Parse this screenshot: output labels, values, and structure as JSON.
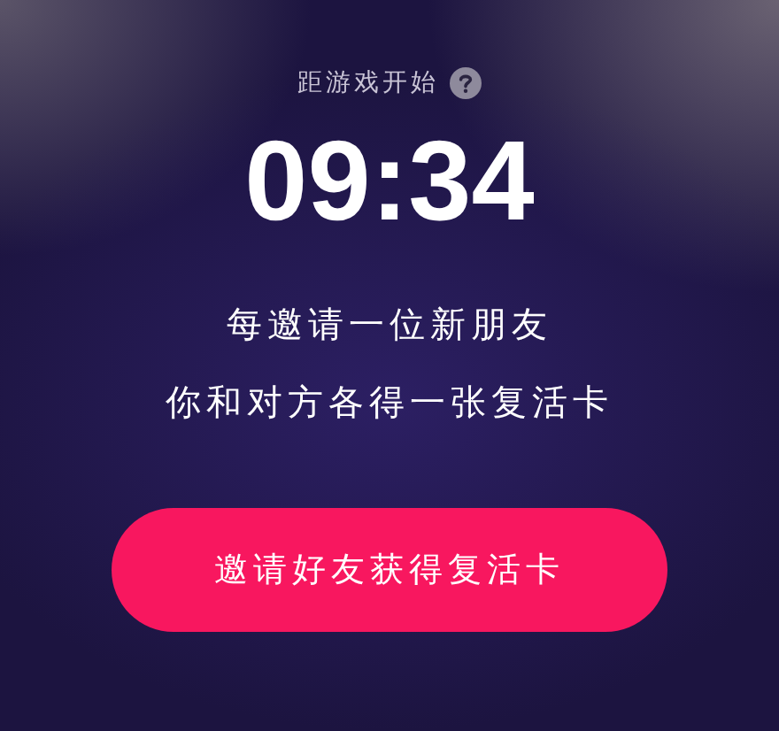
{
  "countdown": {
    "label": "距游戏开始",
    "time": "09:34"
  },
  "message": [
    "每邀请一位新朋友",
    "你和对方各得一张复活卡"
  ],
  "invite_button": {
    "label": "邀请好友获得复活卡"
  }
}
